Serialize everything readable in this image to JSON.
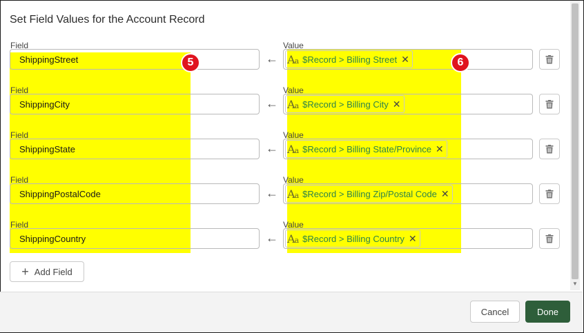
{
  "dialog": {
    "title": "Set Field Values for the Account Record",
    "field_label": "Field",
    "value_label": "Value",
    "add_field_label": "Add Field",
    "cancel_label": "Cancel",
    "done_label": "Done"
  },
  "badges": [
    "5",
    "6"
  ],
  "rows": [
    {
      "field": "ShippingStreet",
      "value": "$Record > Billing Street"
    },
    {
      "field": "ShippingCity",
      "value": "$Record > Billing City"
    },
    {
      "field": "ShippingState",
      "value": "$Record > Billing State/Province"
    },
    {
      "field": "ShippingPostalCode",
      "value": "$Record > Billing Zip/Postal Code"
    },
    {
      "field": "ShippingCountry",
      "value": "$Record > Billing Country"
    }
  ],
  "icons": {
    "arrow": "arrow-left-icon",
    "text_type": "text-type-icon",
    "remove": "close-icon",
    "delete": "trash-icon",
    "add": "plus-icon"
  },
  "colors": {
    "highlight": "#ffff00",
    "value_text": "#2e844a",
    "badge": "#e0141e",
    "done_button": "#2e5e3a"
  }
}
